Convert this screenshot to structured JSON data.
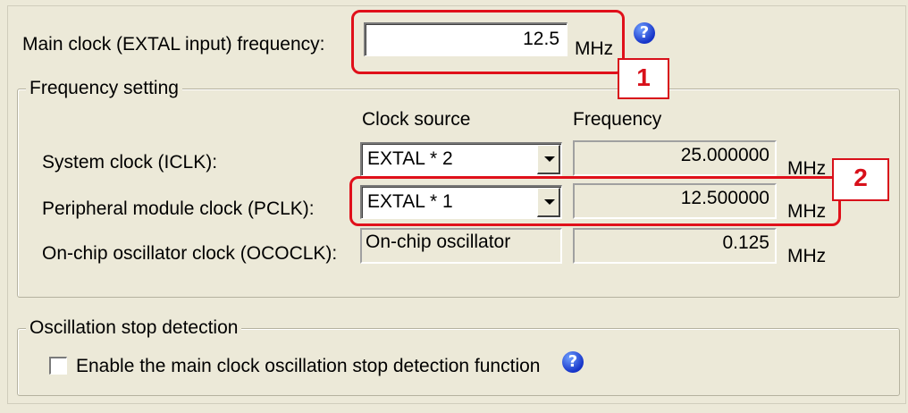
{
  "main_clock": {
    "label": "Main clock (EXTAL input) frequency:",
    "value": "12.5",
    "unit": "MHz"
  },
  "frequency_setting": {
    "legend": "Frequency setting",
    "col_source": "Clock source",
    "col_frequency": "Frequency",
    "rows": [
      {
        "label": "System clock (ICLK):",
        "source": "EXTAL * 2",
        "frequency": "25.000000",
        "unit": "MHz"
      },
      {
        "label": "Peripheral module clock (PCLK):",
        "source": "EXTAL * 1",
        "frequency": "12.500000",
        "unit": "MHz"
      },
      {
        "label": "On-chip oscillator clock (OCOCLK):",
        "source": "On-chip oscillator",
        "frequency": "0.125",
        "unit": "MHz"
      }
    ]
  },
  "oscillation_stop": {
    "legend": "Oscillation stop detection",
    "checkbox_label": "Enable the main clock oscillation stop detection function",
    "checked": false
  },
  "help_icon": "?",
  "callouts": {
    "one": "1",
    "two": "2"
  },
  "colors": {
    "highlight": "#e0101a",
    "help_icon": "#1634c8",
    "background": "#ece9d8"
  }
}
